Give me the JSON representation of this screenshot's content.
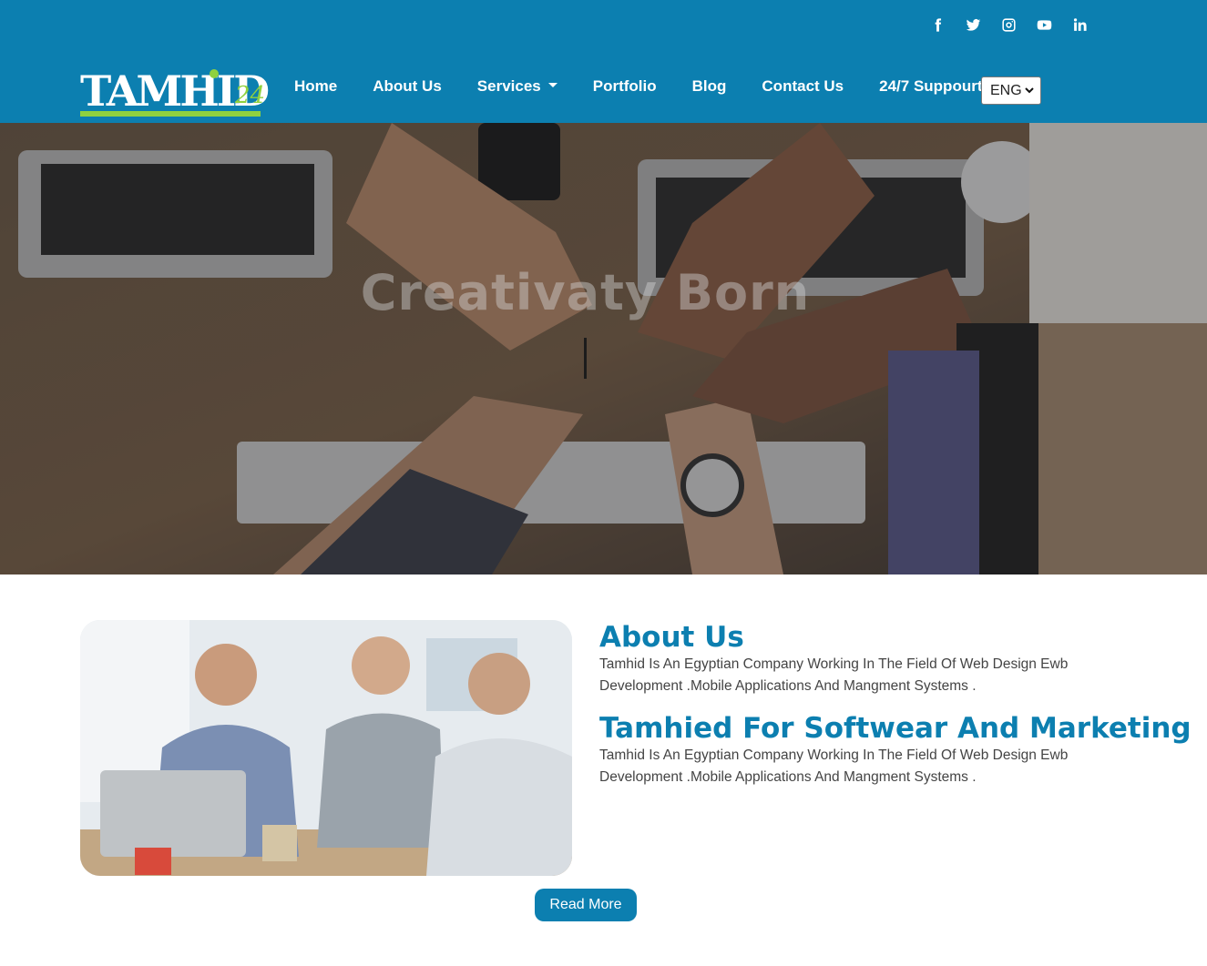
{
  "header": {
    "social": [
      {
        "icon": "facebook-icon"
      },
      {
        "icon": "twitter-icon"
      },
      {
        "icon": "instagram-icon"
      },
      {
        "icon": "youtube-icon"
      },
      {
        "icon": "linkedin-icon"
      }
    ],
    "logo": {
      "text": "TAMHID",
      "suffix": "24"
    },
    "nav": {
      "home": "Home",
      "about": "About Us",
      "services": "Services",
      "portfolio": "Portfolio",
      "blog": "Blog",
      "contact": "Contact Us",
      "support": "24/7 Suppourt"
    },
    "language": {
      "selected": "ENG"
    }
  },
  "hero": {
    "title": "Creativaty Born"
  },
  "about": {
    "title": "About Us",
    "text1": "Tamhid Is An Egyptian Company Working In The Field Of Web Design Ewb Development .Mobile Applications And Mangment Systems .",
    "subtitle": "Tamhied For Softwear And Marketing",
    "text2": "Tamhid Is An Egyptian Company Working In The Field Of Web Design Ewb Development .Mobile Applications And Mangment Systems .",
    "read_more": "Read More"
  },
  "colors": {
    "brand": "#0c7fb0",
    "accent": "#8fd13f"
  }
}
